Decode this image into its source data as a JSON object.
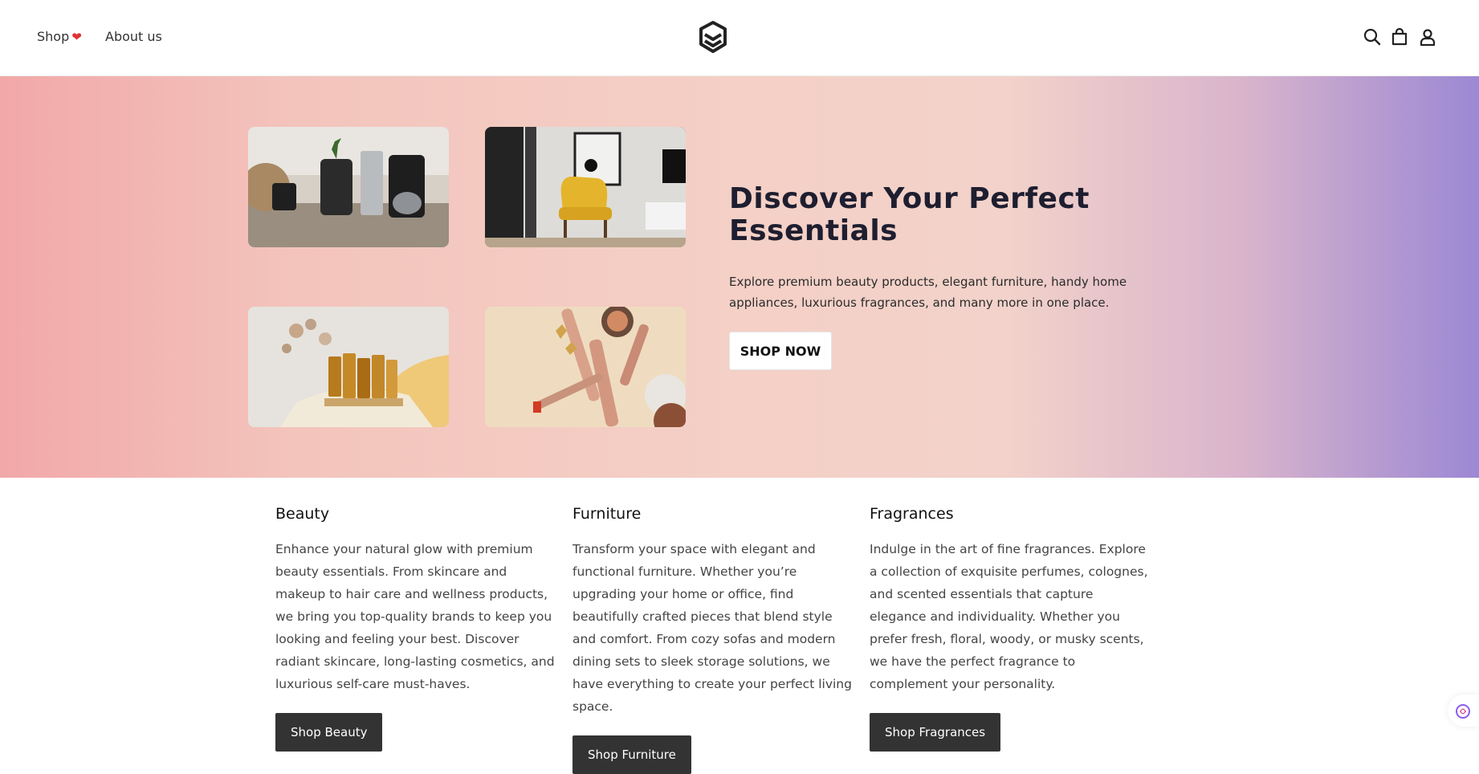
{
  "nav": {
    "shop_label": "Shop",
    "about_label": "About us"
  },
  "header_icons": [
    "store-logo-icon",
    "search-icon",
    "shopping-bag-icon",
    "user-icon"
  ],
  "hero": {
    "title": "Discover Your Perfect Essentials",
    "description": "Explore premium beauty products, elegant furniture, handy home appliances, luxurious fragrances, and many more in one place.",
    "cta_label": "SHOP NOW",
    "images": [
      "coffee-appliances-photo",
      "yellow-armchair-photo",
      "perfume-bottles-photo",
      "makeup-products-photo"
    ]
  },
  "categories": [
    {
      "title": "Beauty",
      "description": "Enhance your natural glow with premium beauty essentials. From skincare and makeup to hair care and wellness products, we bring you top-quality brands to keep you looking and feeling your best. Discover radiant skincare, long-lasting cosmetics, and luxurious self-care must-haves.",
      "button_label": "Shop Beauty"
    },
    {
      "title": "Furniture",
      "description": "Transform your space with elegant and functional furniture. Whether you’re upgrading your home or office, find beautifully crafted pieces that blend style and comfort. From cozy sofas and modern dining sets to sleek storage solutions, we have everything to create your perfect living space.",
      "button_label": "Shop Furniture"
    },
    {
      "title": "Fragrances",
      "description": "Indulge in the art of fine fragrances. Explore a collection of exquisite perfumes, colognes, and scented essentials that capture elegance and individuality. Whether you prefer fresh, floral, woody, or musky scents, we have the perfect fragrance to complement your personality.",
      "button_label": "Shop Fragrances"
    }
  ],
  "colors": {
    "hero_gradient_start": "#f2a8a8",
    "hero_gradient_end": "#9c88d4",
    "button_dark": "#333333",
    "heart": "#e03131"
  }
}
